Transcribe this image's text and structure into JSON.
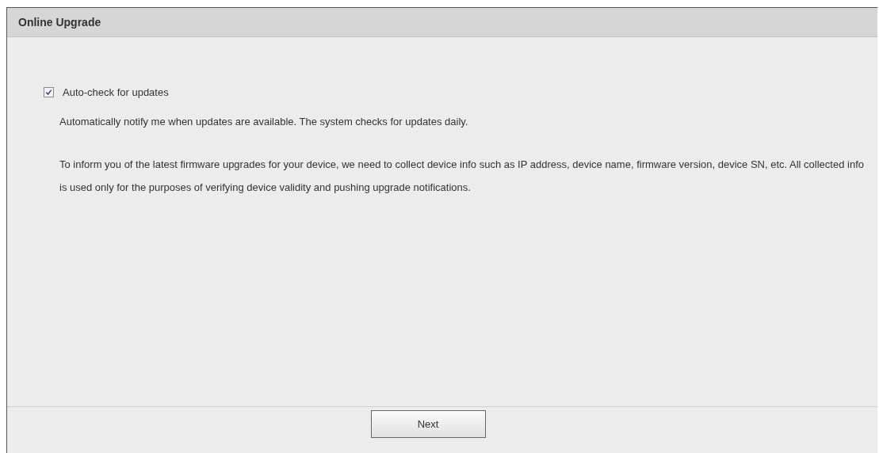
{
  "panel": {
    "title": "Online Upgrade"
  },
  "auto_check": {
    "label": "Auto-check for updates",
    "checked": true
  },
  "description": "Automatically notify me when updates are available. The system checks for updates daily.",
  "notice": "To inform you of the latest firmware upgrades for your device, we need to collect device info such as IP address, device name, firmware version, device SN, etc. All collected info is used only for the purposes of verifying device validity and pushing upgrade notifications.",
  "buttons": [
    {
      "label": "Next"
    }
  ]
}
